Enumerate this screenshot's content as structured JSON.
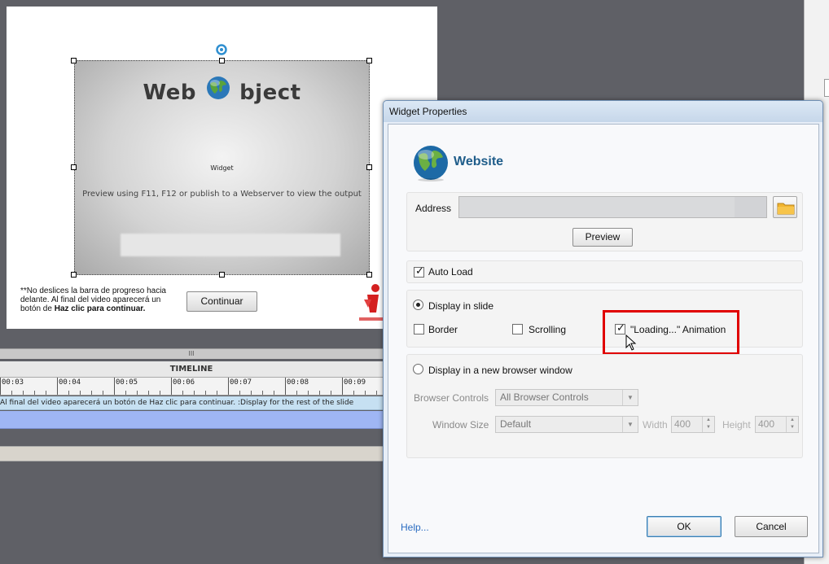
{
  "slide": {
    "widget_title_part1": "Web",
    "widget_title_part2": "bject",
    "widget_label": "Widget",
    "widget_preview_text": "Preview using F11, F12 or publish to a Webserver to view the output",
    "note_line1": "**No deslices la barra de progreso hacia",
    "note_line2": "delante. Al final del video aparecerá un",
    "note_line3_prefix": "botón de ",
    "note_line3_bold": "Haz clic para continuar.",
    "continue_button": "Continuar"
  },
  "timeline": {
    "grip": "III",
    "title": "TIMELINE",
    "ruler_labels": [
      "00:03",
      "00:04",
      "00:05",
      "00:06",
      "00:07",
      "00:08",
      "00:09"
    ],
    "caption_track": "Al final del video aparecerá un botón de Haz clic para continuar.  :Display for the rest of the slide"
  },
  "dialog": {
    "window_title": "Widget Properties",
    "header_title": "Website",
    "address_label": "Address",
    "address_value": "",
    "preview_button": "Preview",
    "auto_load_label": "Auto Load",
    "auto_load_checked": true,
    "display_in_slide_label": "Display in slide",
    "display_in_slide_selected": true,
    "border_label": "Border",
    "border_checked": false,
    "scrolling_label": "Scrolling",
    "scrolling_checked": false,
    "loading_animation_label": "\"Loading...\" Animation",
    "loading_animation_checked": true,
    "new_window_label": "Display in a new browser window",
    "new_window_selected": false,
    "browser_controls_label": "Browser Controls",
    "browser_controls_value": "All Browser Controls",
    "window_size_label": "Window Size",
    "window_size_value": "Default",
    "width_label": "Width",
    "width_value": "400",
    "height_label": "Height",
    "height_value": "400",
    "help_link": "Help...",
    "ok_button": "OK",
    "cancel_button": "Cancel"
  },
  "colors": {
    "header_title": "#1f5d8a",
    "highlight_border": "#e00000",
    "help_link": "#2a6cc1"
  }
}
